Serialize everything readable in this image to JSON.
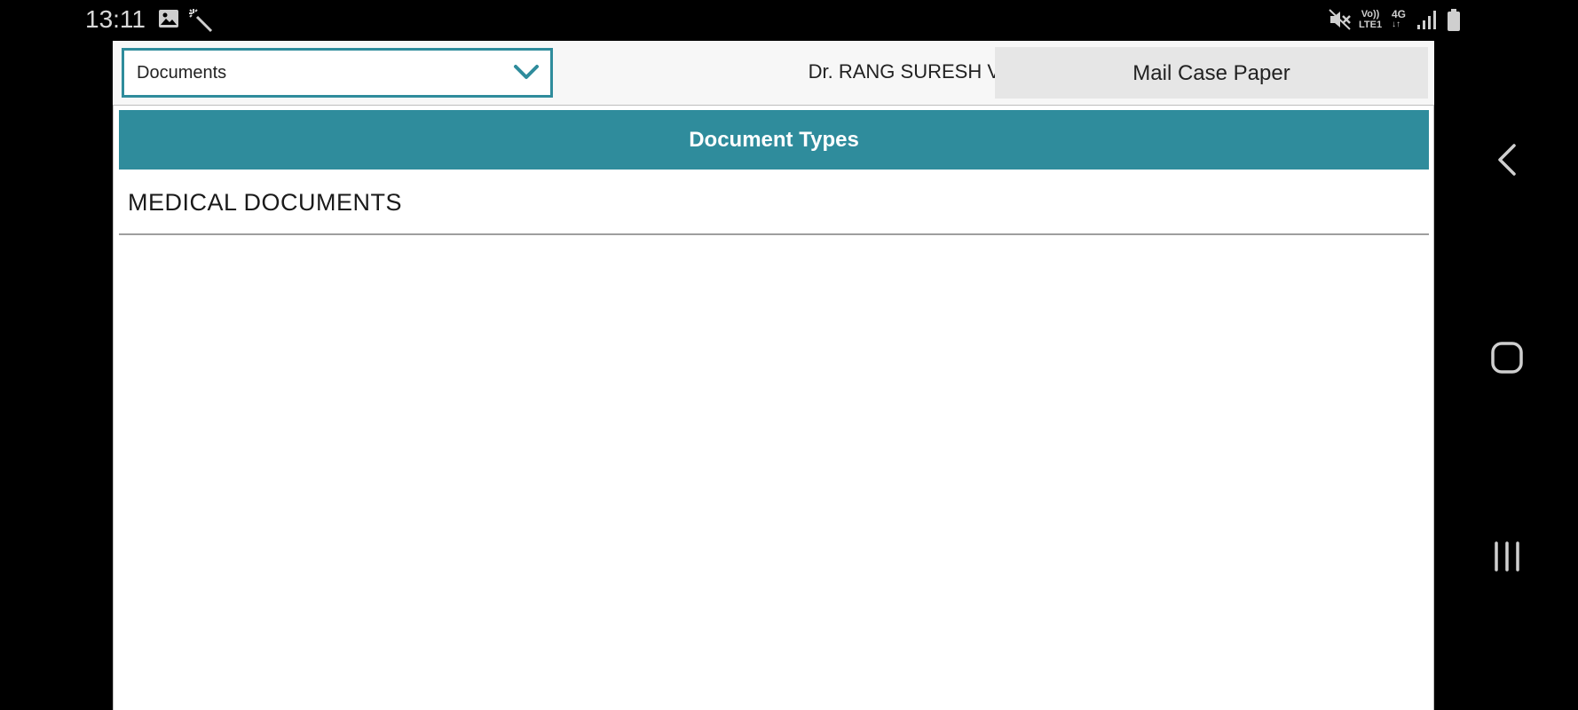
{
  "status_bar": {
    "time": "13:11",
    "icons": [
      "gallery-icon",
      "magic-wand-icon",
      "mute-icon",
      "volte-icon",
      "4g-icon",
      "signal-icon",
      "battery-icon"
    ],
    "volte_line1": "Vo))",
    "volte_line2": "LTE1",
    "network_label": "4G"
  },
  "header": {
    "dropdown_value": "Documents",
    "doctor_name": "Dr. RANG SURESH V",
    "mail_button_label": "Mail Case Paper"
  },
  "content": {
    "section_title": "Document Types",
    "items": [
      {
        "label": "MEDICAL DOCUMENTS"
      }
    ]
  },
  "navigation": {
    "buttons": [
      "back-icon",
      "home-icon",
      "recents-icon"
    ]
  },
  "colors": {
    "accent": "#2f8c9c",
    "header_bg": "#f7f7f7",
    "button_bg": "#e6e6e6",
    "system_bg": "#000000"
  }
}
